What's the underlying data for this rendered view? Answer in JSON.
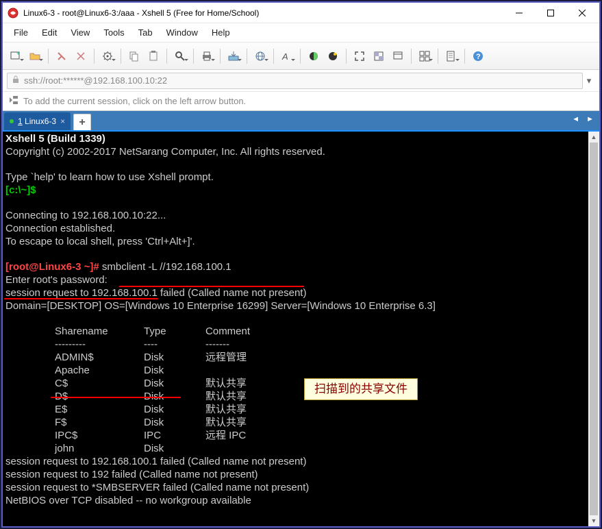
{
  "title": "Linux6-3 - root@Linux6-3:/aaa - Xshell 5 (Free for Home/School)",
  "menu": {
    "file": "File",
    "edit": "Edit",
    "view": "View",
    "tools": "Tools",
    "tab": "Tab",
    "window": "Window",
    "help": "Help"
  },
  "address": "ssh://root:******@192.168.100.10:22",
  "hint": "To add the current session, click on the left arrow button.",
  "tab": {
    "index": "1",
    "label": "Linux6-3"
  },
  "term": {
    "banner1": "Xshell 5 (Build 1339)",
    "banner2": "Copyright (c) 2002-2017 NetSarang Computer, Inc. All rights reserved.",
    "help": "Type `help' to learn how to use Xshell prompt.",
    "localprompt": "[c:\\~]$",
    "connecting": "Connecting to 192.168.100.10:22...",
    "established": "Connection established.",
    "escape": "To escape to local shell, press 'Ctrl+Alt+]'.",
    "prompt_user": "[root@Linux6-3 ~]#",
    "cmd": " smbclient -L //192.168.100.1",
    "passprompt": "Enter root's password:",
    "sess1": "session request to 192.168.100.1 failed (Called name not present)",
    "domain": "Domain=[DESKTOP] OS=[Windows 10 Enterprise 16299] Server=[Windows 10 Enterprise 6.3]",
    "hdr_share": "Sharename",
    "hdr_type": "Type",
    "hdr_comment": "Comment",
    "hdr_dash1": "---------",
    "hdr_dash2": "----",
    "hdr_dash3": "-------",
    "rows": [
      {
        "n": "ADMIN$",
        "t": "Disk",
        "c": "远程管理"
      },
      {
        "n": "Apache",
        "t": "Disk",
        "c": ""
      },
      {
        "n": "C$",
        "t": "Disk",
        "c": "默认共享"
      },
      {
        "n": "D$",
        "t": "Disk",
        "c": "默认共享"
      },
      {
        "n": "E$",
        "t": "Disk",
        "c": "默认共享"
      },
      {
        "n": "F$",
        "t": "Disk",
        "c": "默认共享"
      },
      {
        "n": "IPC$",
        "t": "IPC",
        "c": "远程 IPC"
      },
      {
        "n": "john",
        "t": "Disk",
        "c": ""
      }
    ],
    "sess2": "session request to 192.168.100.1 failed (Called name not present)",
    "sess3": "session request to 192 failed (Called name not present)",
    "sess4": "session request to *SMBSERVER failed (Called name not present)",
    "netbios": "NetBIOS over TCP disabled -- no workgroup available"
  },
  "callout": "扫描到的共享文件"
}
